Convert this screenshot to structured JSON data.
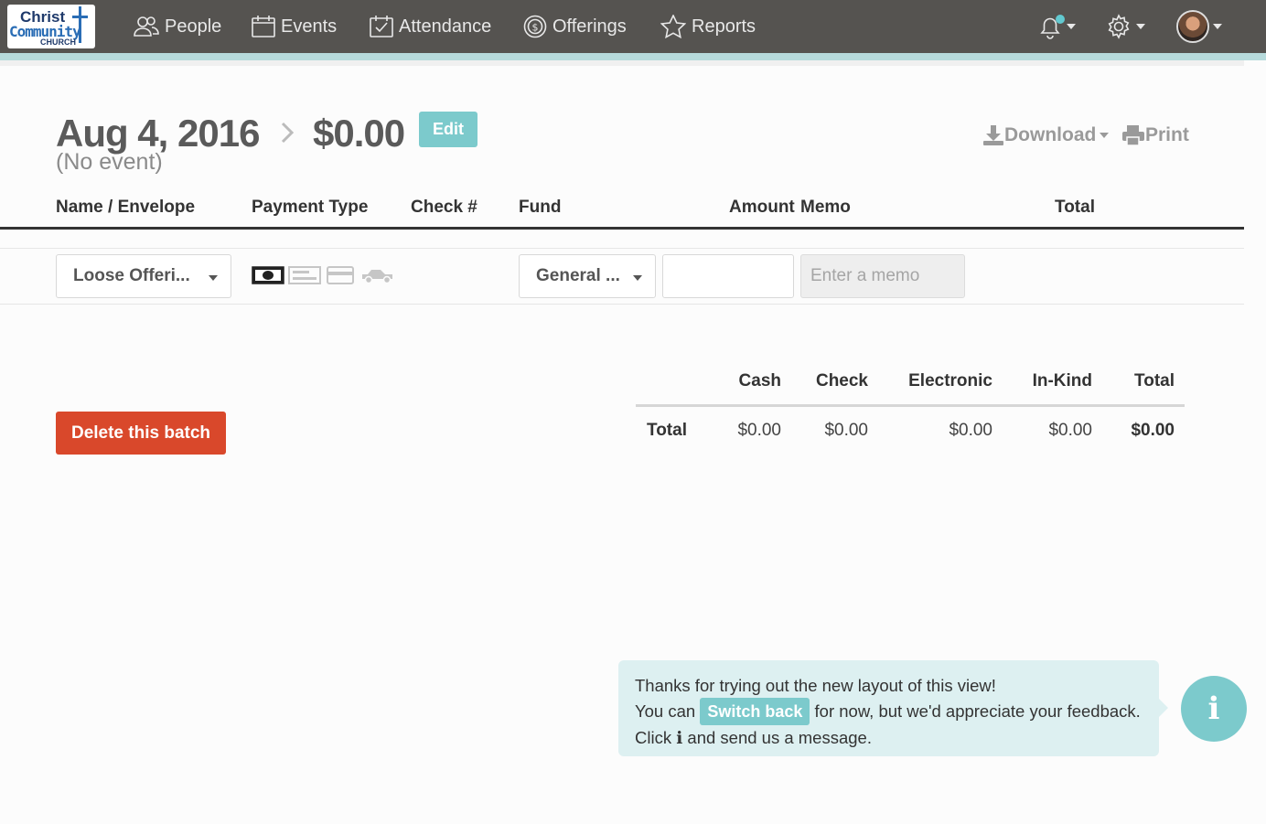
{
  "logo": {
    "line1": "Christ",
    "line2": "Community",
    "line3": "CHURCH"
  },
  "nav": {
    "people": "People",
    "events": "Events",
    "attendance": "Attendance",
    "offerings": "Offerings",
    "reports": "Reports"
  },
  "header": {
    "date": "Aug 4, 2016",
    "amount": "$0.00",
    "edit_label": "Edit",
    "subtitle": "(No event)",
    "download_label": "Download",
    "print_label": "Print"
  },
  "table": {
    "columns": [
      "Name / Envelope",
      "Payment Type",
      "Check #",
      "Fund",
      "Amount",
      "Memo",
      "Total"
    ],
    "row": {
      "name_select": "Loose Offeri...",
      "fund_select": "General ...",
      "amount_value": "",
      "memo_placeholder": "Enter a memo"
    },
    "payment_types": [
      "cash-icon",
      "check-icon",
      "credit-card-icon",
      "in-kind-icon"
    ]
  },
  "actions": {
    "delete_label": "Delete this batch"
  },
  "summary": {
    "headers": [
      "Cash",
      "Check",
      "Electronic",
      "In-Kind",
      "Total"
    ],
    "row_label": "Total",
    "values": [
      "$0.00",
      "$0.00",
      "$0.00",
      "$0.00",
      "$0.00"
    ]
  },
  "toast": {
    "line1": "Thanks for trying out the new layout of this view!",
    "line2_pre": "You can",
    "switch_label": "Switch back",
    "line2_post": "for now, but we'd appreciate your feedback.",
    "line3_pre": "Click",
    "line3_post": "and send us a message.",
    "info_glyph": "i"
  },
  "colors": {
    "nav_bg": "#555350",
    "accent": "#7ccacc",
    "danger": "#d9482b",
    "notify_dot": "#62c9d0"
  }
}
